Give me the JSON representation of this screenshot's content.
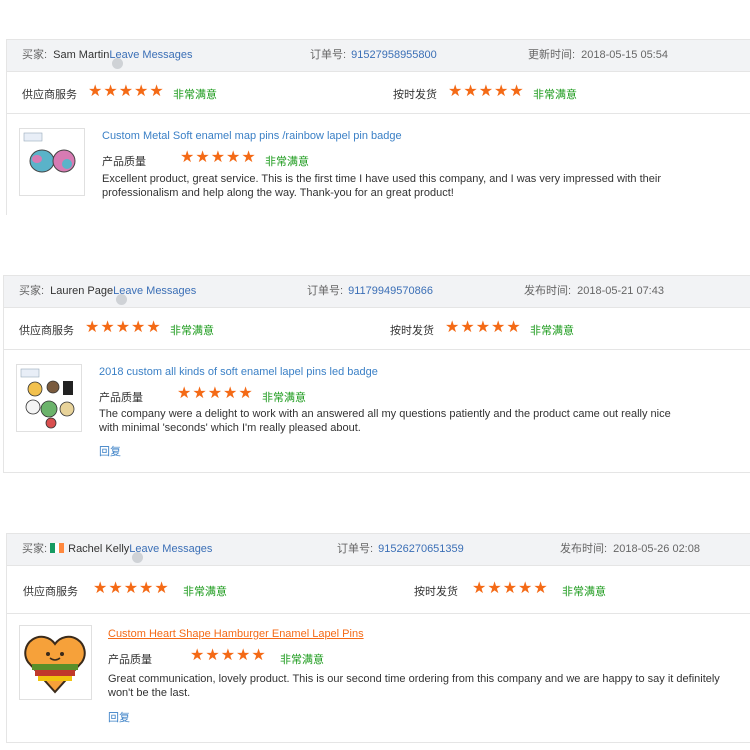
{
  "labels": {
    "buyer": "买家:",
    "order": "订单号:",
    "supplier_service": "供应商服务",
    "on_time": "按时发货",
    "quality": "产品质量",
    "very_satisfied": "非常满意",
    "leave_messages": "Leave Messages",
    "reply": "回复",
    "stars": "★★★★★"
  },
  "reviews": [
    {
      "buyer_name": "Sam Martin",
      "order_no": "91527958955800",
      "date_label": "更新时间:",
      "date": "2018-05-15 05:54",
      "product_title": "Custom Metal Soft enamel map pins /rainbow lapel pin badge",
      "review_text": "Excellent product, great service. This is the first time I have used this company, and I was very impressed with their professionalism and help along the way. Thank-you for an great product!",
      "rating_supplier": 5,
      "rating_on_time": 5,
      "rating_quality": 5
    },
    {
      "buyer_name": "Lauren Page",
      "order_no": "91179949570866",
      "date_label": "发布时间:",
      "date": "2018-05-21 07:43",
      "product_title": "2018 custom all kinds of soft enamel lapel pins led badge",
      "review_text": "The company were a delight to work with an answered all my questions patiently and the product came out really nice with minimal 'seconds' which I'm really pleased about.",
      "rating_supplier": 5,
      "rating_on_time": 5,
      "rating_quality": 5
    },
    {
      "buyer_name": "Rachel Kelly",
      "country_flag": "ireland-flag-icon",
      "order_no": "91526270651359",
      "date_label": "发布时间:",
      "date": "2018-05-26 02:08",
      "product_title": "Custom Heart Shape Hamburger Enamel Lapel Pins",
      "review_text": "Great communication, lovely product. This is our second time ordering from this company and we are happy to say it definitely won't be the last.",
      "rating_supplier": 5,
      "rating_on_time": 5,
      "rating_quality": 5
    }
  ],
  "colors": {
    "star": "#f46a16",
    "satisfied": "#1a9a1a",
    "link": "#3b80c6",
    "header_bg": "#f2f3f5"
  }
}
